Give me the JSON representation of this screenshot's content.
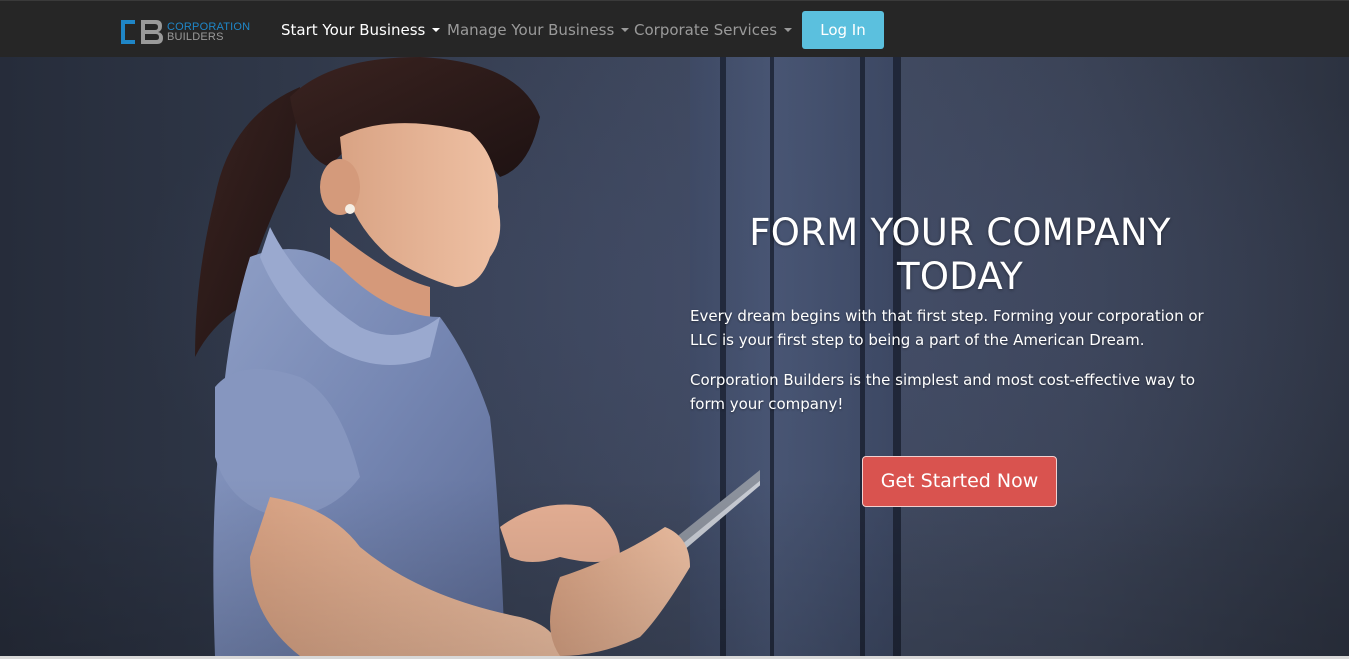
{
  "brand": {
    "logo_mark": "CB",
    "logo_line1": "CORPORATION",
    "logo_line2": "BUILDERS",
    "primary_color": "#1f86c7",
    "secondary_color": "#9a9a9a"
  },
  "nav": {
    "items": [
      {
        "label": "Start Your Business",
        "active": true,
        "has_dropdown": true
      },
      {
        "label": "Manage Your Business",
        "active": false,
        "has_dropdown": true
      },
      {
        "label": "Corporate Services",
        "active": false,
        "has_dropdown": true
      }
    ],
    "login_label": "Log In",
    "login_color": "#5bc0de"
  },
  "hero": {
    "title": "FORM YOUR COMPANY TODAY",
    "paragraph1": "Every dream begins with that first step. Forming your corporation or LLC is your first step to being a part of the American Dream.",
    "paragraph2": "Corporation Builders is the simplest and most cost-effective way to form your company!",
    "cta_label": "Get Started Now",
    "cta_color": "#d9534f",
    "image_description_icon": "woman-with-tablet-photo"
  }
}
